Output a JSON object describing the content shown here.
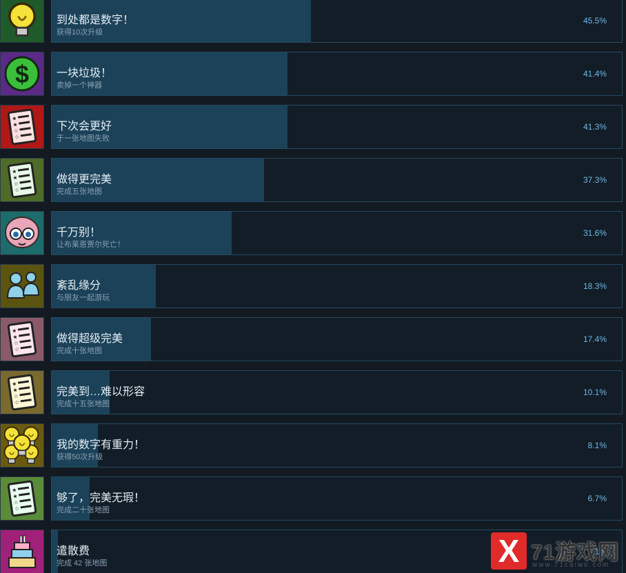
{
  "achievements": [
    {
      "title": "到处都是数字！",
      "desc": "获得10次升级",
      "percent": "45.5%",
      "value": 45.5,
      "icon": "lightbulb-icon"
    },
    {
      "title": "一块垃圾！",
      "desc": "卖掉一个神器",
      "percent": "41.4%",
      "value": 41.4,
      "icon": "dollar-coin-icon"
    },
    {
      "title": "下次会更好",
      "desc": "于一张地图失败",
      "percent": "41.3%",
      "value": 41.3,
      "icon": "failed-map-checklist-icon"
    },
    {
      "title": "做得更完美",
      "desc": "完成五张地图",
      "percent": "37.3%",
      "value": 37.3,
      "icon": "green-checklist-icon"
    },
    {
      "title": "千万别！",
      "desc": "让布莱恩贾尔死亡！",
      "percent": "31.6%",
      "value": 31.6,
      "icon": "creature-face-icon"
    },
    {
      "title": "紊乱缘分",
      "desc": "与朋友一起游玩",
      "percent": "18.3%",
      "value": 18.3,
      "icon": "friends-icon"
    },
    {
      "title": "做得超级完美",
      "desc": "完成十张地图",
      "percent": "17.4%",
      "value": 17.4,
      "icon": "pink-checklist-icon"
    },
    {
      "title": "完美到…难以形容",
      "desc": "完成十五张地图",
      "percent": "10.1%",
      "value": 10.1,
      "icon": "yellow-checklist-icon"
    },
    {
      "title": "我的数字有重力！",
      "desc": "获得50次升级",
      "percent": "8.1%",
      "value": 8.1,
      "icon": "many-lightbulbs-icon"
    },
    {
      "title": "够了，完美无瑕！",
      "desc": "完成二十张地图",
      "percent": "6.7%",
      "value": 6.7,
      "icon": "light-green-checklist-icon"
    },
    {
      "title": "遣散费",
      "desc": "完成 42 张地图",
      "percent": "1.1%",
      "value": 1.1,
      "icon": "cake-icon"
    }
  ],
  "watermark": {
    "logo": "X",
    "name": "71游戏网",
    "url": "www.71caiwo.com"
  }
}
